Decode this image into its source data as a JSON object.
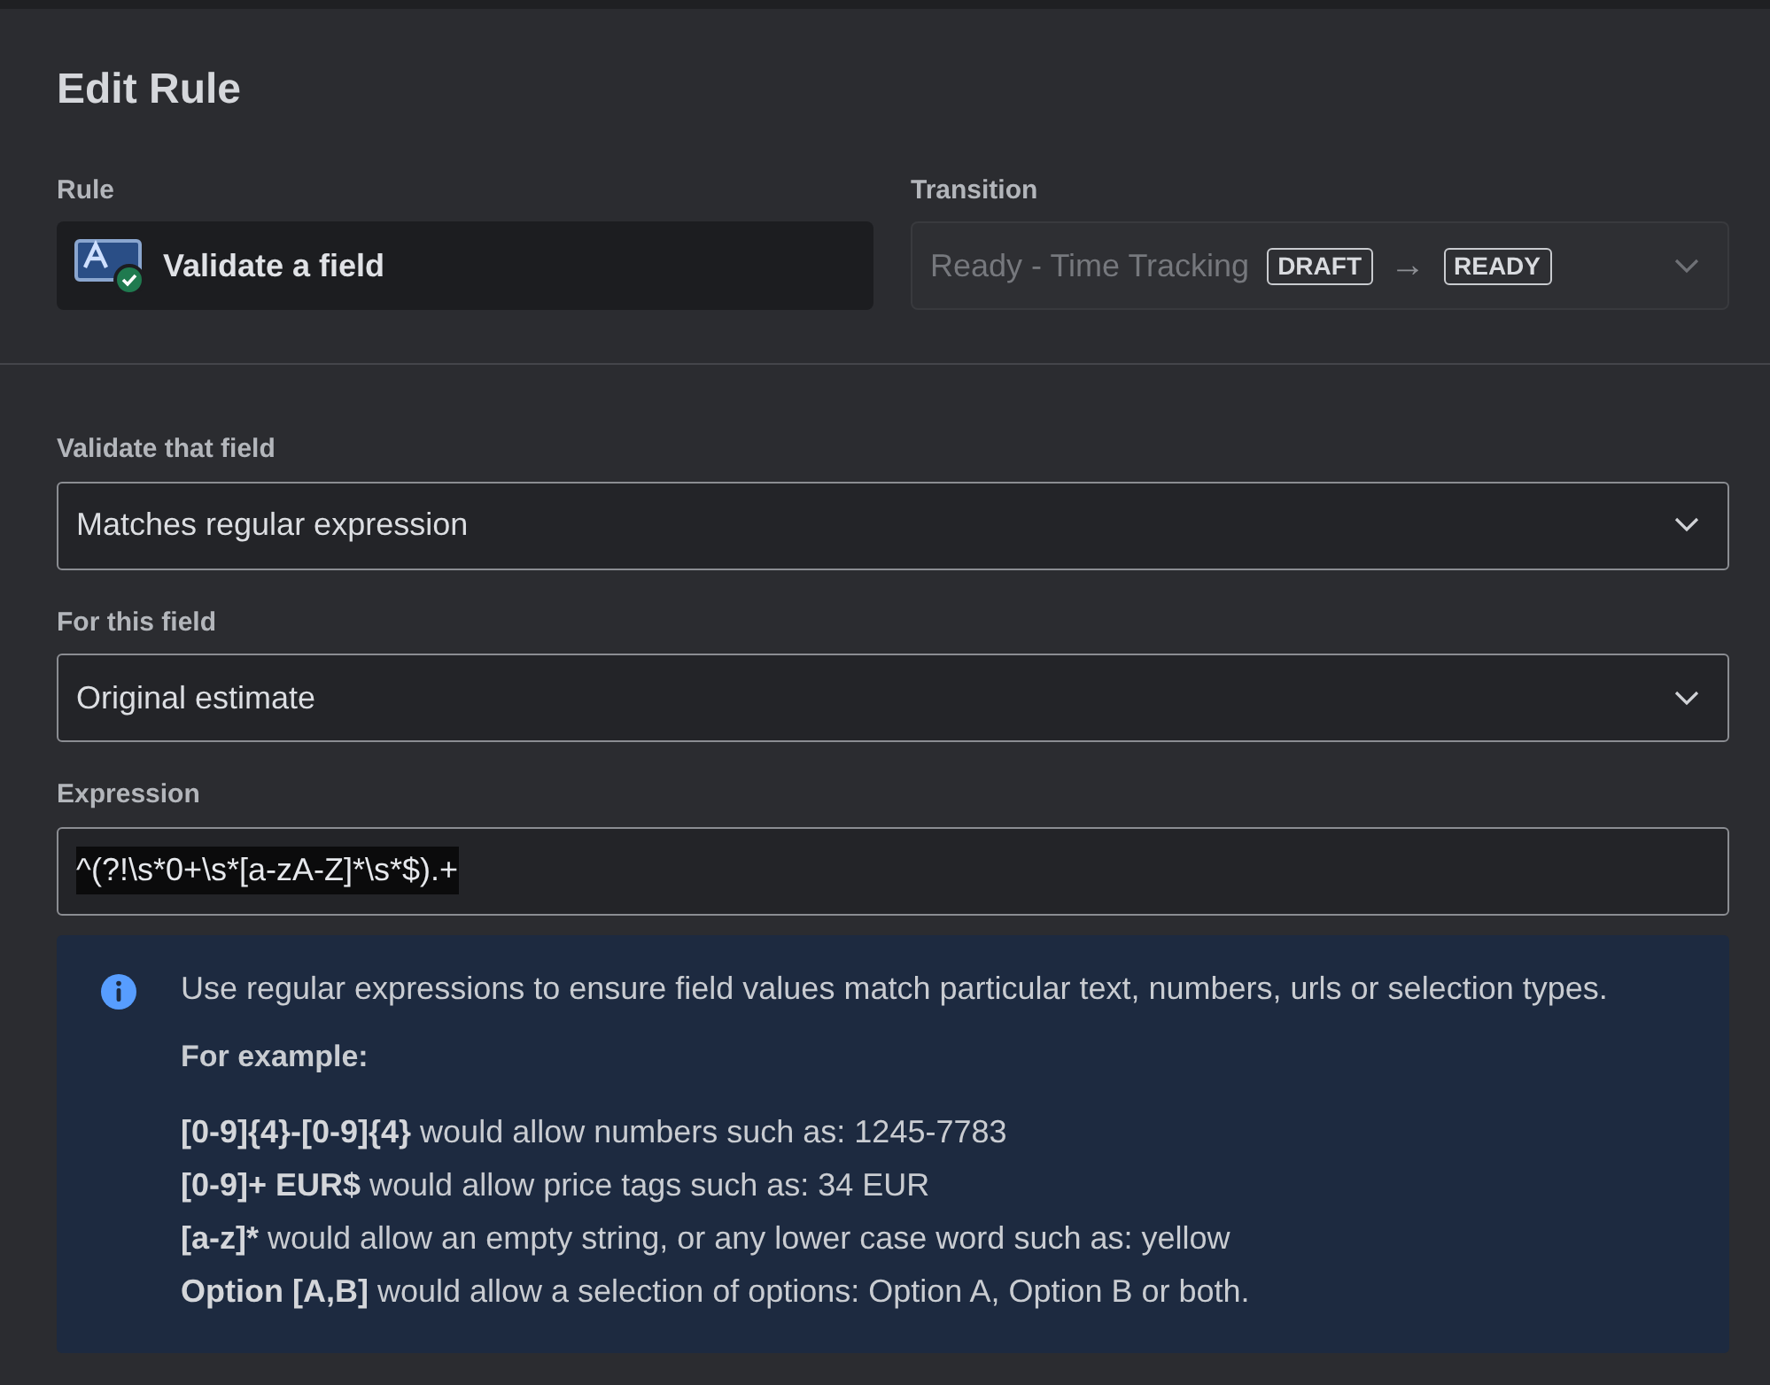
{
  "dialog": {
    "title": "Edit Rule"
  },
  "rule": {
    "label": "Rule",
    "value": "Validate a field"
  },
  "transition": {
    "label": "Transition",
    "value": "Ready - Time Tracking",
    "from": "DRAFT",
    "arrow": "→",
    "to": "READY",
    "disabled": true
  },
  "fields": [
    {
      "kind": "select",
      "label": "Validate that field",
      "value": "Matches regular expression"
    },
    {
      "kind": "select",
      "label": "For this field",
      "value": "Original estimate"
    },
    {
      "kind": "text",
      "label": "Expression",
      "value": "^(?!\\s*0+\\s*[a-zA-Z]*\\s*$).+",
      "text_selected": true
    }
  ],
  "info": {
    "message": "Use regular expressions to ensure field values match particular text, numbers, urls or selection types.",
    "heading": "For example:",
    "examples": [
      {
        "pattern": "[0-9]{4}-[0-9]{4}",
        "description": "would allow numbers such as: 1245-7783"
      },
      {
        "pattern": "[0-9]+ EUR$",
        "description": "would allow price tags such as: 34 EUR"
      },
      {
        "pattern": "[a-z]*",
        "description": "would allow an empty string, or any lower case word such as: yellow"
      },
      {
        "pattern": "Option [A,B]",
        "description": "would allow a selection of options: Option A, Option B or both."
      }
    ]
  }
}
